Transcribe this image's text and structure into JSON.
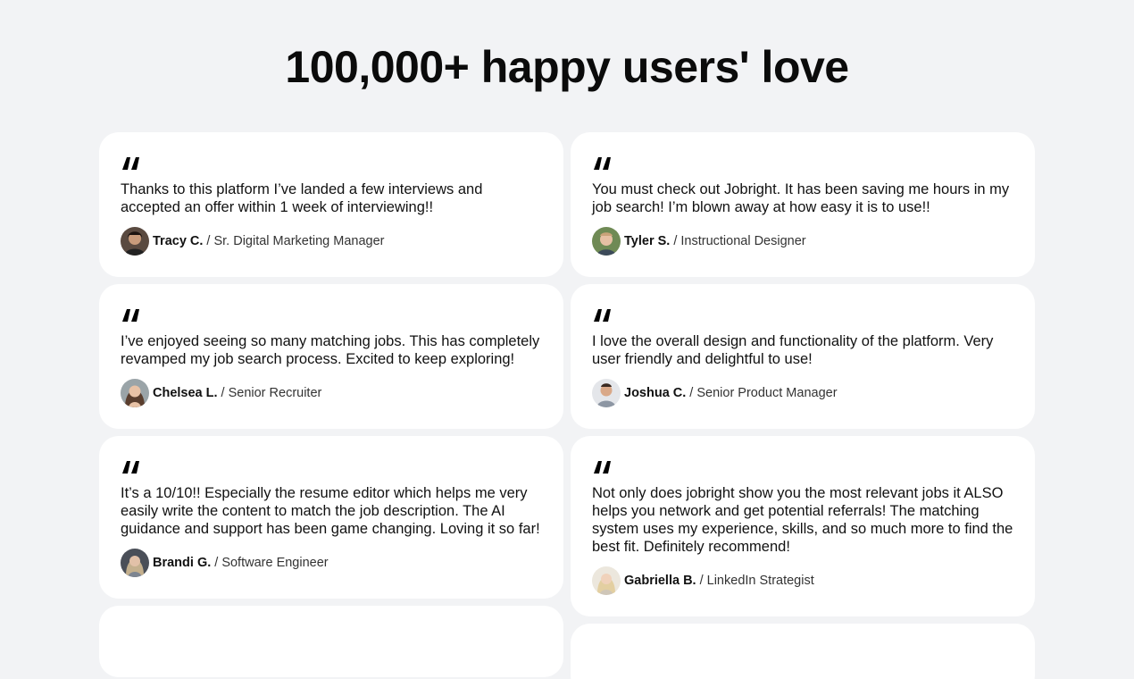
{
  "page": {
    "title": "100,000+ happy users' love"
  },
  "testimonials_left": [
    {
      "text": "Thanks to this platform I’ve landed a few interviews and accepted an offer within 1 week of interviewing!!",
      "name": "Tracy C.",
      "role": "/ Sr. Digital Marketing Manager",
      "avatar_color": "#3b2a22"
    },
    {
      "text": "I’ve enjoyed seeing so many matching jobs. This has completely revamped my job search process. Excited to keep exploring!",
      "name": "Chelsea L.",
      "role": "/ Senior Recruiter",
      "avatar_color": "#7a5b48"
    },
    {
      "text": "It’s a 10/10!! Especially the resume editor which helps me very easily write the content to match the job description. The AI guidance and support has been game changing. Loving it so far!",
      "name": "Brandi G.",
      "role": "/ Software Engineer",
      "avatar_color": "#8a8f9a"
    }
  ],
  "testimonials_right": [
    {
      "text": "You must check out Jobright. It has been saving me hours in my job search! I’m blown away at how easy it is to use!!",
      "name": "Tyler S.",
      "role": "/ Instructional Designer",
      "avatar_color": "#5d7a4a"
    },
    {
      "text": "I love the overall design and functionality of the platform. Very user friendly and delightful to use!",
      "name": "Joshua C.",
      "role": "/ Senior Product Manager",
      "avatar_color": "#c9ccd2"
    },
    {
      "text": "Not only does jobright show you the most relevant jobs it ALSO helps you network and get potential referrals! The matching system uses my experience, skills, and so much more to find the best fit. Definitely recommend!",
      "name": "Gabriella B.",
      "role": "/ LinkedIn Strategist",
      "avatar_color": "#d9cdb8"
    }
  ],
  "icons": {
    "quote": "quote-icon"
  }
}
